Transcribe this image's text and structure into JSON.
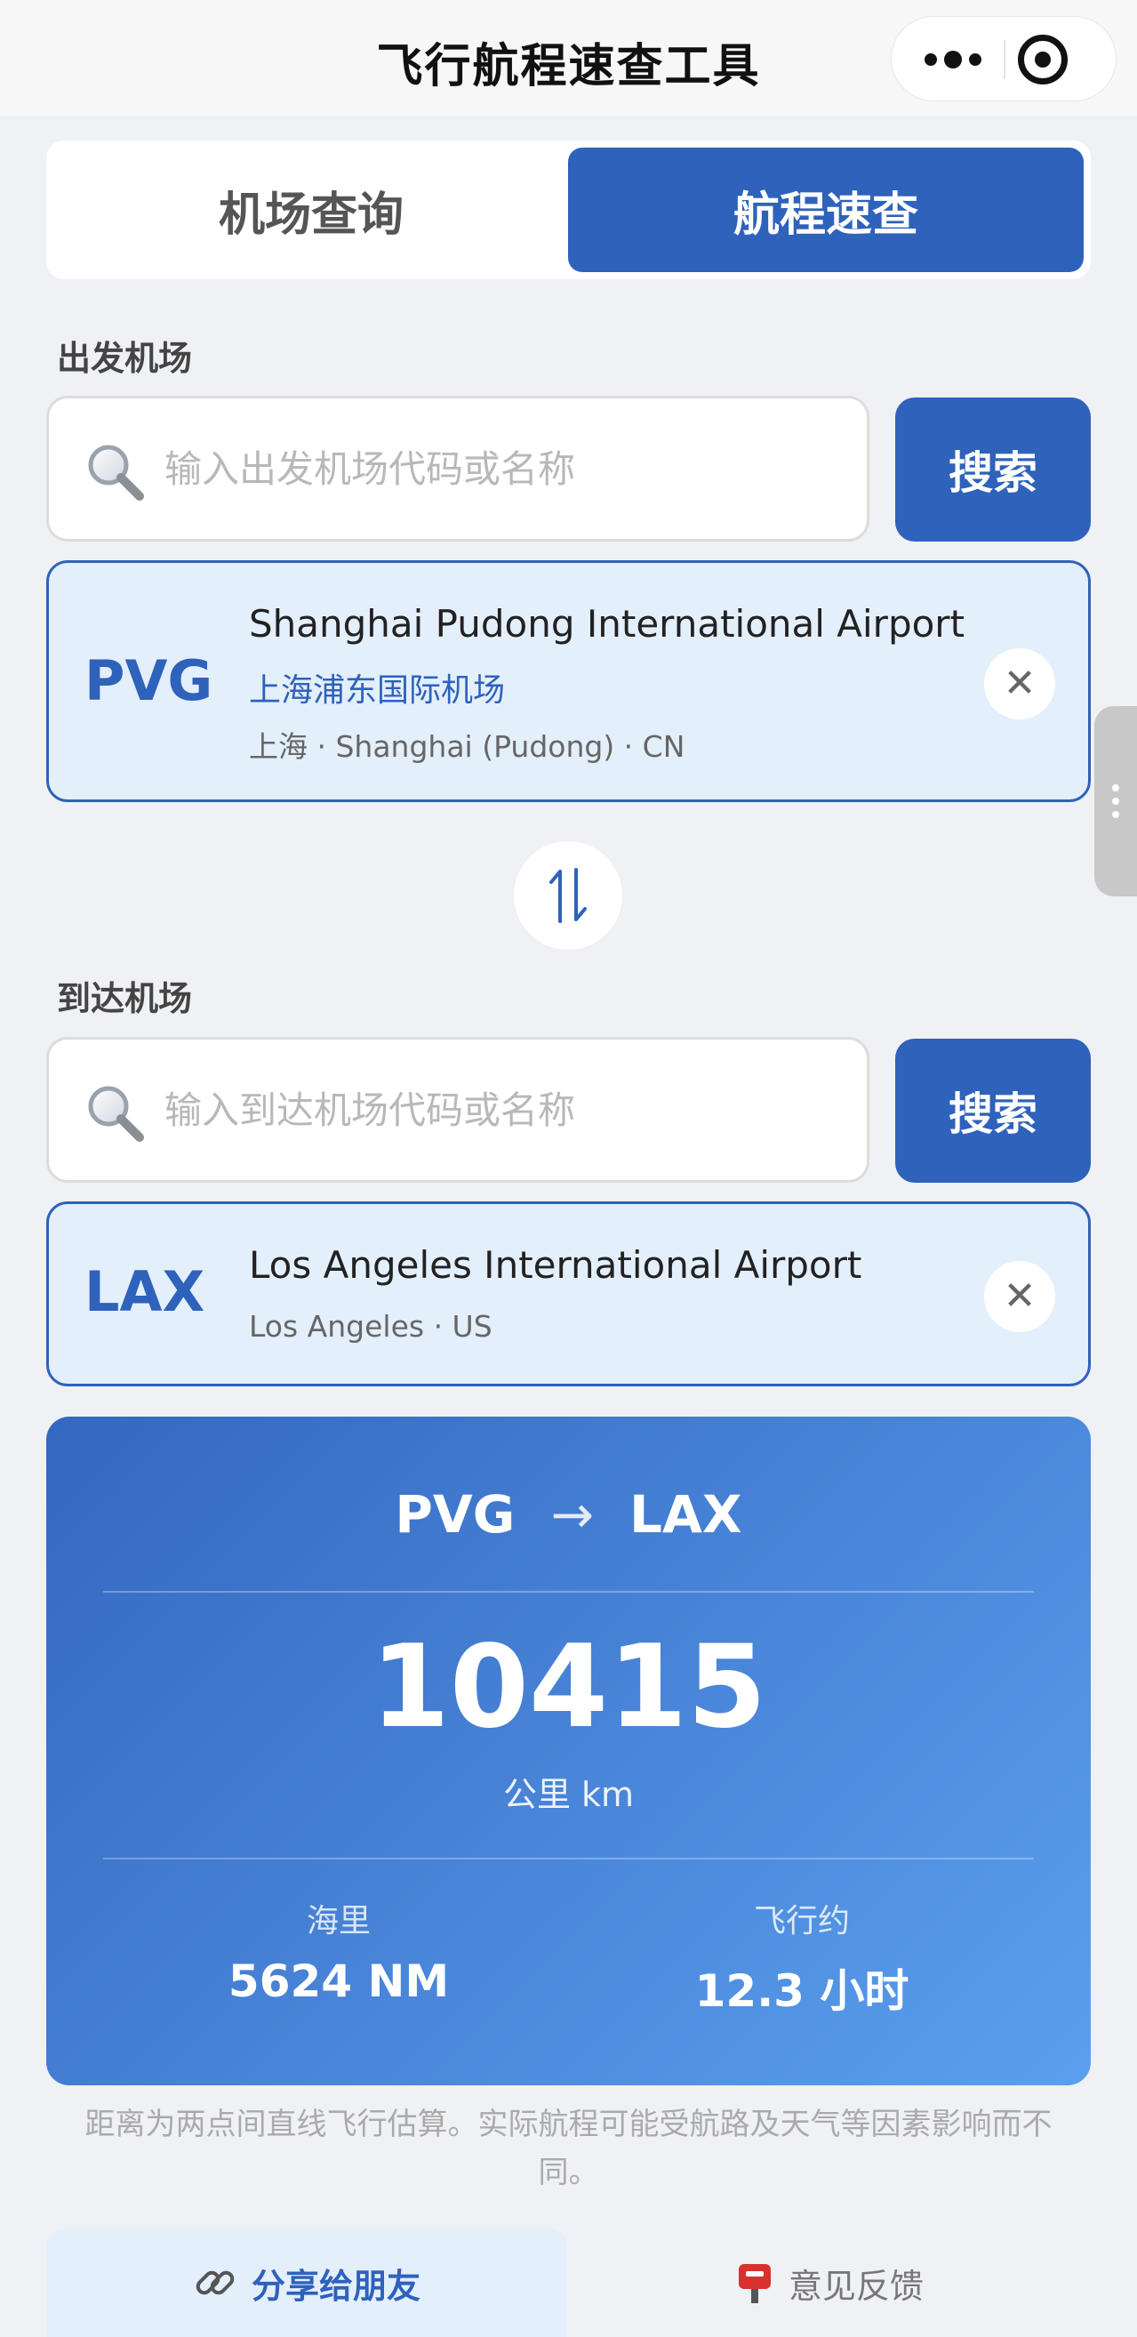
{
  "app": {
    "title": "飞行航程速查工具"
  },
  "tabs": [
    {
      "label": "机场查询",
      "active": false
    },
    {
      "label": "航程速查",
      "active": true
    }
  ],
  "departure": {
    "section_label": "出发机场",
    "search_placeholder": "输入出发机场代码或名称",
    "search_value": "",
    "search_button": "搜索",
    "selected": {
      "code": "PVG",
      "name_en": "Shanghai Pudong International Airport",
      "name_cn": "上海浦东国际机场",
      "location": "上海 · Shanghai (Pudong) · CN"
    },
    "clear_glyph": "✕"
  },
  "arrival": {
    "section_label": "到达机场",
    "search_placeholder": "输入到达机场代码或名称",
    "search_value": "",
    "search_button": "搜索",
    "selected": {
      "code": "LAX",
      "name_en": "Los Angeles International Airport",
      "location": "Los Angeles · US"
    },
    "clear_glyph": "✕"
  },
  "result": {
    "from": "PVG",
    "arrow": "→",
    "to": "LAX",
    "distance_km": "10415",
    "distance_unit": "公里 km",
    "nautical_label": "海里",
    "nautical_value": "5624 NM",
    "flight_label": "飞行约",
    "flight_value": "12.3 小时"
  },
  "disclaimer": "距离为两点间直线飞行估算。实际航程可能受航路及天气等因素影响而不同。",
  "actions": {
    "share_label": "分享给朋友",
    "feedback_label": "意见反馈"
  },
  "icons": {
    "capsule_more": "more-dots-icon",
    "capsule_close": "target-close-icon",
    "search": "search-icon",
    "swap": "swap-vertical-icon",
    "share": "link-icon",
    "feedback": "mailbox-icon"
  },
  "colors": {
    "accent": "#2e62bb",
    "card_bg": "#e4effc",
    "page_bg": "#f0f1f5",
    "gradient_start": "#3468c1",
    "gradient_end": "#5aa0ee"
  }
}
